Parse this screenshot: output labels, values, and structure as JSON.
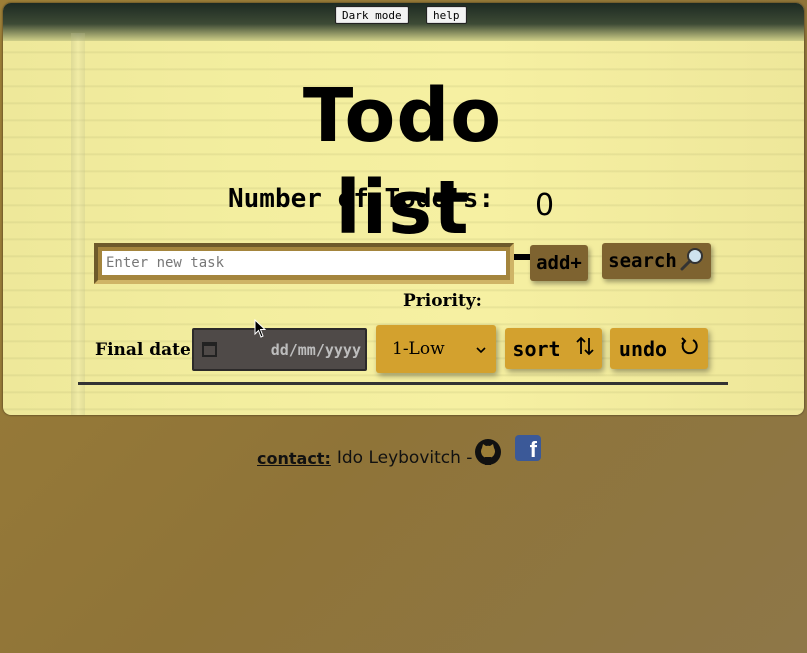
{
  "header": {
    "dark_mode_label": "Dark mode",
    "help_label": "help"
  },
  "main": {
    "title": "Todo list",
    "count_label": "Number of Todo's:",
    "count_value": "0",
    "task_placeholder": "Enter new task",
    "task_value": "",
    "add_label": "add+",
    "search_label": "search",
    "search_icon": "magnifier-icon",
    "priority_label": "Priority:",
    "final_date_label": "Final date:",
    "date_placeholder": "dd/mm/yyyy",
    "priority_selected": "1-Low",
    "sort_label": "sort",
    "sort_icon": "sort-arrows-icon",
    "undo_label": "undo",
    "undo_icon": "undo-icon"
  },
  "footer": {
    "contact_label": "contact:",
    "author": "Ido Leybovitch -",
    "links": [
      "github-icon",
      "facebook-icon"
    ]
  },
  "colors": {
    "paper": "#f3ee9f",
    "page_background": "#9c7e37",
    "brown_button": "#7e6330",
    "gold_button": "#d3a12e",
    "date_field": "#4f4a48"
  }
}
